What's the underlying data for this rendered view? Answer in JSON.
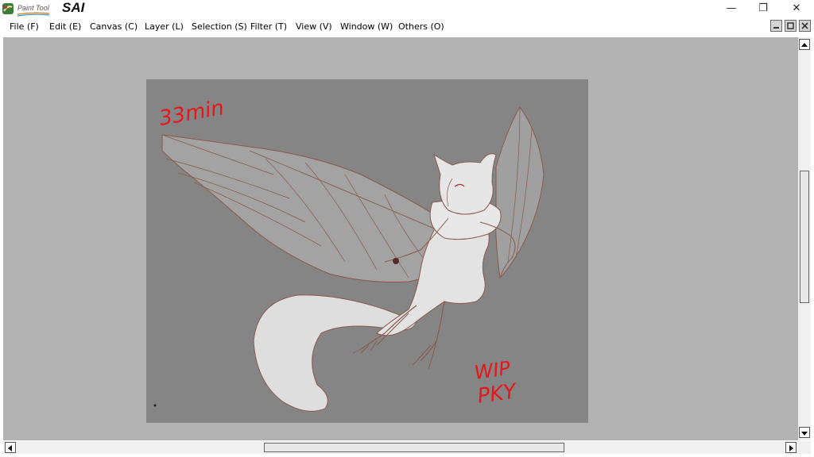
{
  "app": {
    "logo_small": "Paint Tool",
    "logo_big": "SAI"
  },
  "window_controls": {
    "minimize": "—",
    "restore": "❐",
    "close": "✕"
  },
  "menu": [
    {
      "label": "File (F)",
      "name": "menu-file"
    },
    {
      "label": "Edit (E)",
      "name": "menu-edit"
    },
    {
      "label": "Canvas (C)",
      "name": "menu-canvas"
    },
    {
      "label": "Layer (L)",
      "name": "menu-layer"
    },
    {
      "label": "Selection (S)",
      "name": "menu-selection"
    },
    {
      "label": "Filter (T)",
      "name": "menu-filter"
    },
    {
      "label": "View (V)",
      "name": "menu-view"
    },
    {
      "label": "Window (W)",
      "name": "menu-window"
    },
    {
      "label": "Others (O)",
      "name": "menu-others"
    }
  ],
  "canvas": {
    "annotation_time": "33min",
    "annotation_wip": "WIP",
    "annotation_signature": "PKY",
    "annotation_color": "#e8151b"
  },
  "colors": {
    "workspace": "#b2b2b2",
    "canvas_bg": "#858585",
    "lineart": "#8a5a4c"
  }
}
